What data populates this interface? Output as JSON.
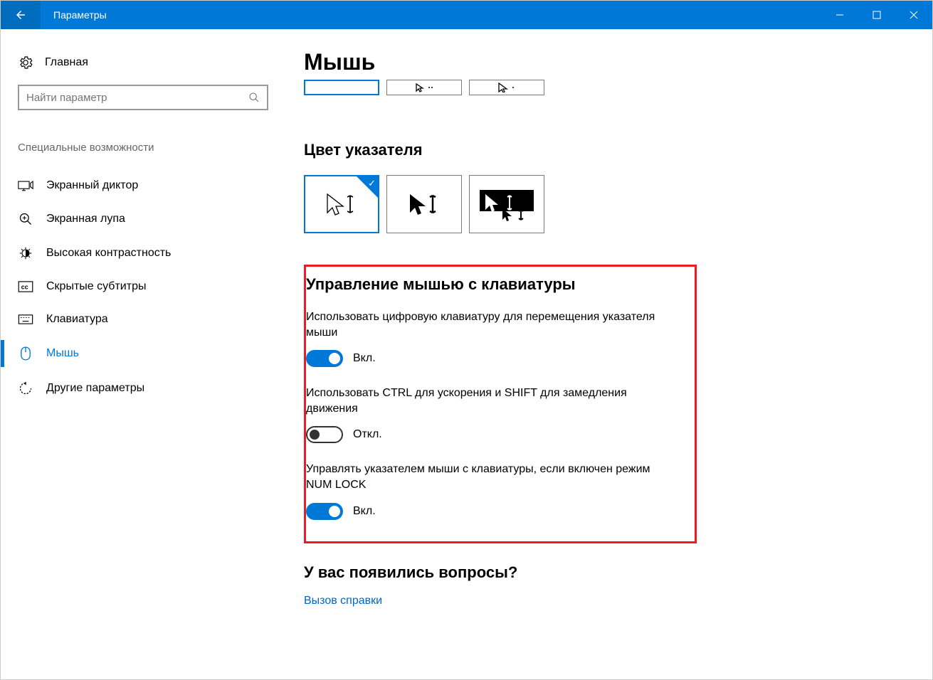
{
  "window": {
    "title": "Параметры"
  },
  "sidebar": {
    "home_label": "Главная",
    "search_placeholder": "Найти параметр",
    "category": "Специальные возможности",
    "items": [
      {
        "label": "Экранный диктор"
      },
      {
        "label": "Экранная лупа"
      },
      {
        "label": "Высокая контрастность"
      },
      {
        "label": "Скрытые субтитры"
      },
      {
        "label": "Клавиатура"
      },
      {
        "label": "Мышь"
      },
      {
        "label": "Другие параметры"
      }
    ]
  },
  "main": {
    "page_title": "Мышь",
    "color_section_title": "Цвет указателя",
    "keyboard_control": {
      "title": "Управление мышью с клавиатуры",
      "setting1_label": "Использовать цифровую клавиатуру для перемещения указателя мыши",
      "setting1_state": "Вкл.",
      "setting2_label": "Использовать CTRL для ускорения и SHIFT для замедления движения",
      "setting2_state": "Откл.",
      "setting3_label": "Управлять указателем мыши с клавиатуры, если включен режим NUM LOCK",
      "setting3_state": "Вкл."
    },
    "questions": {
      "title": "У вас появились вопросы?",
      "help_link": "Вызов справки"
    }
  }
}
